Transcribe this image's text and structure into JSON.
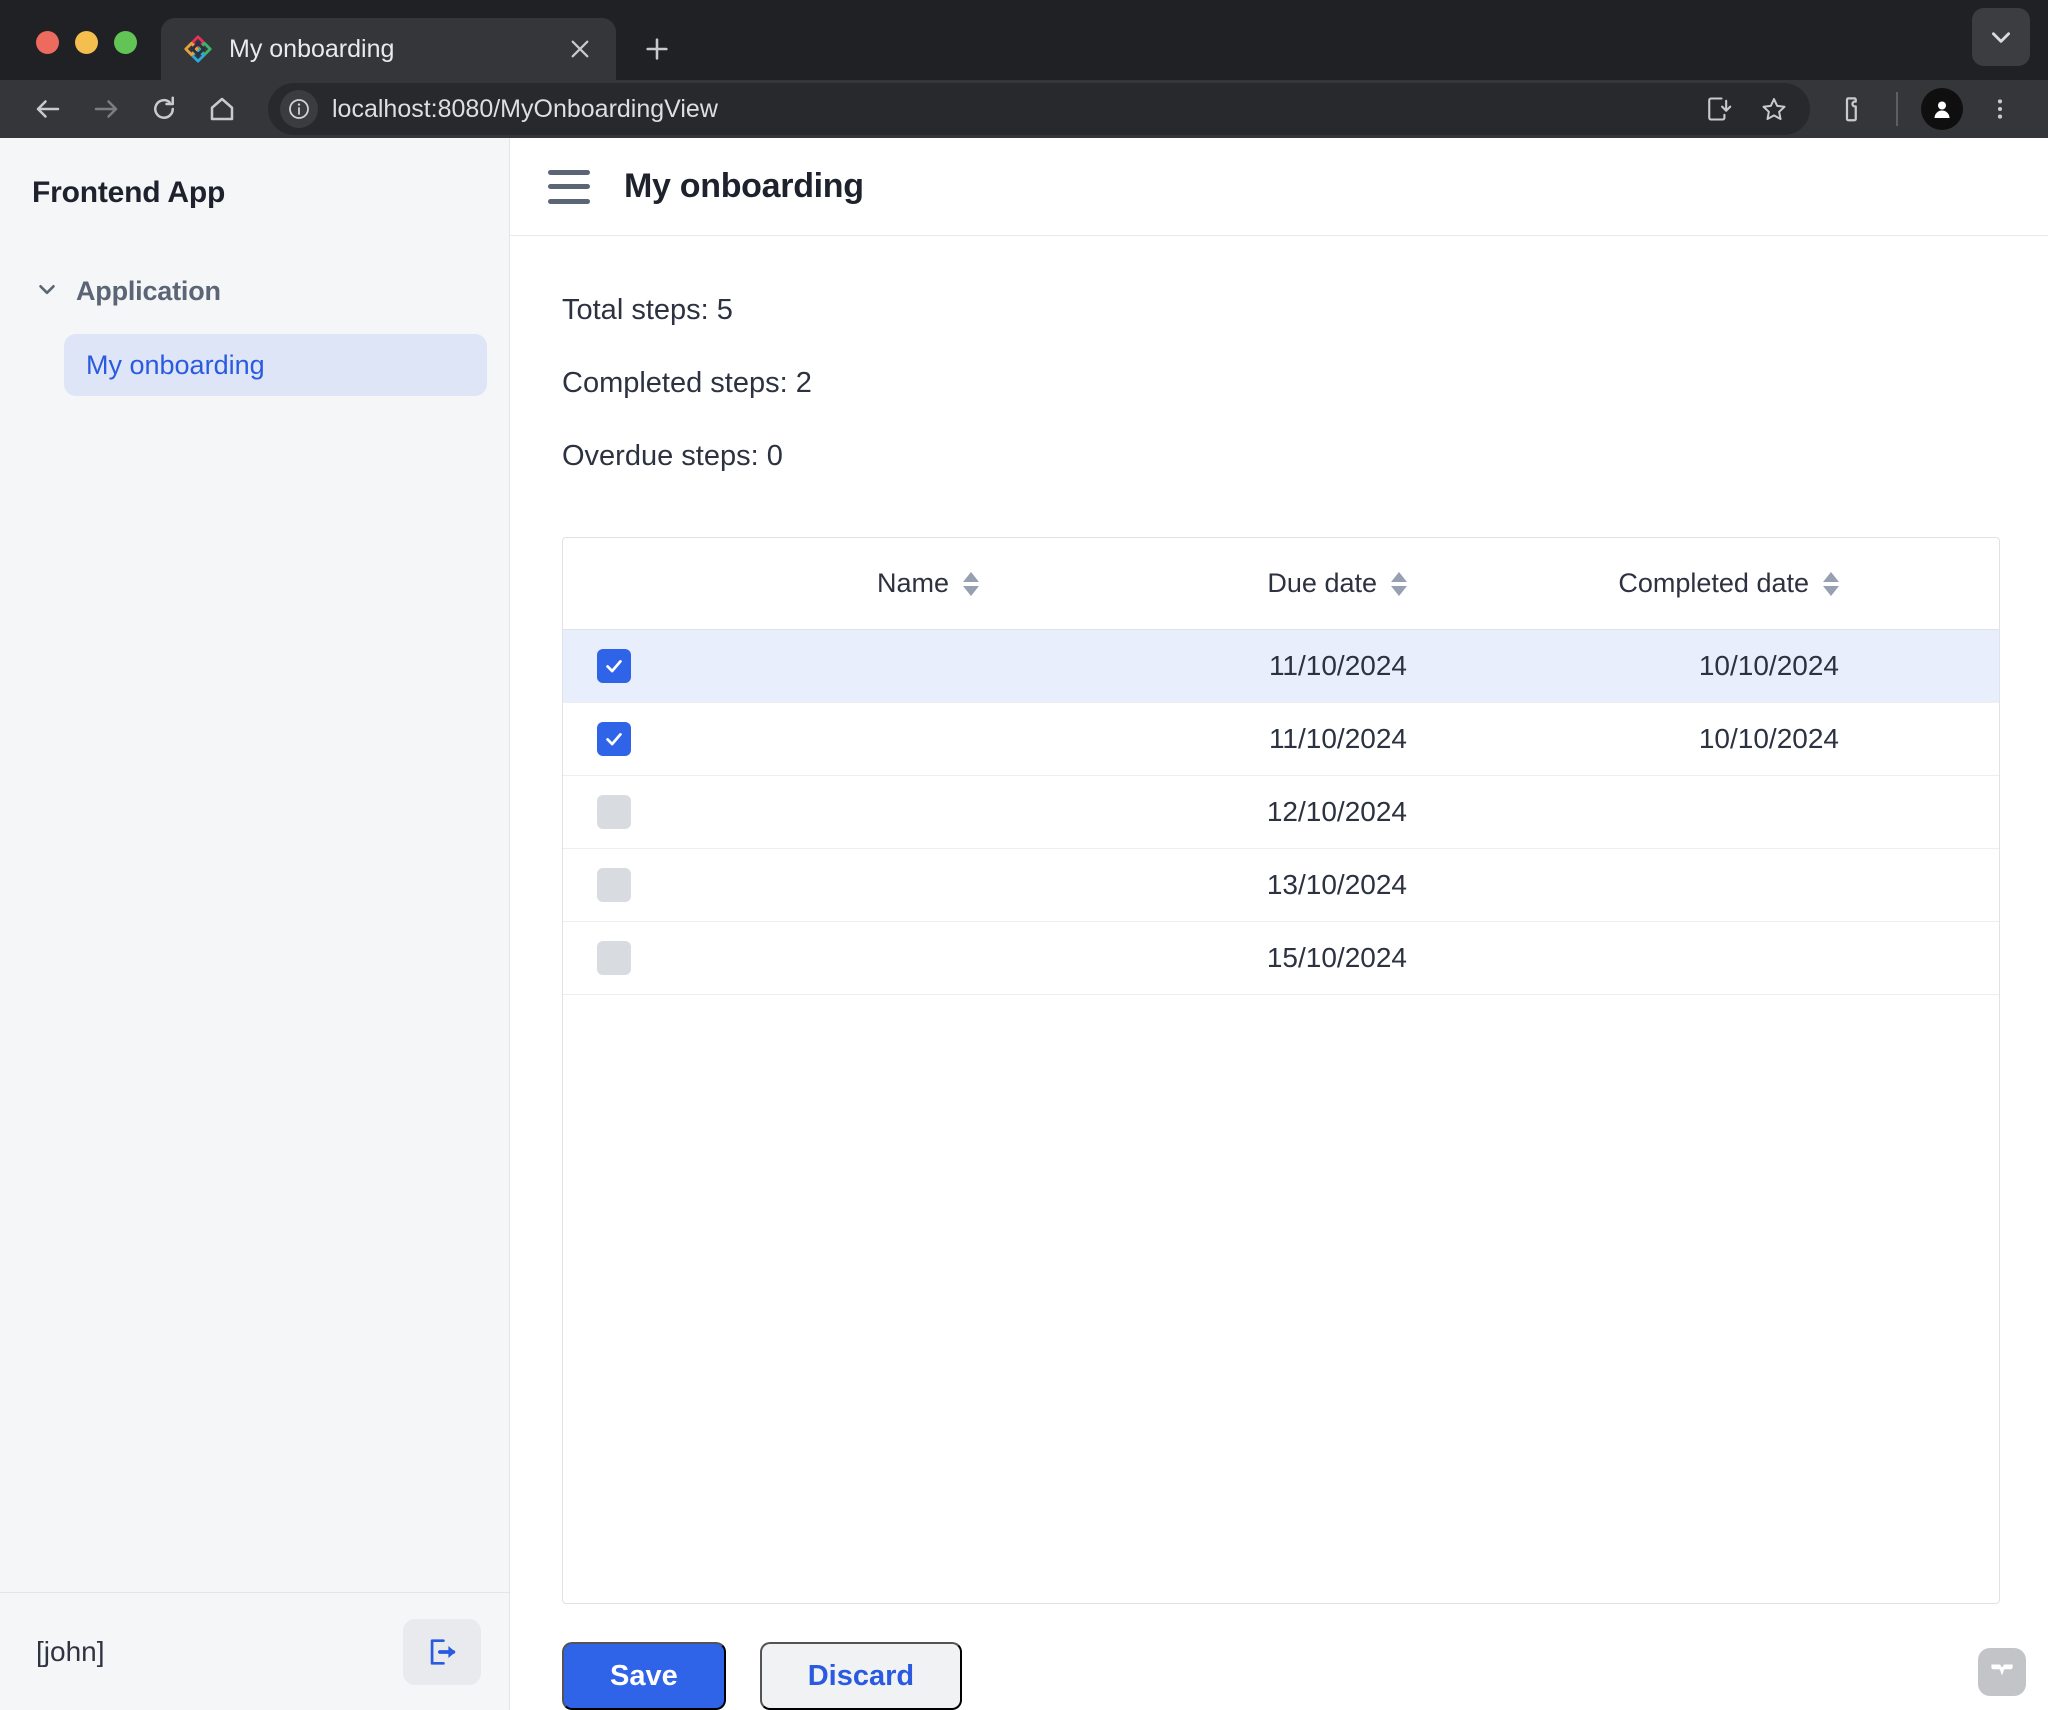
{
  "browser": {
    "tab": {
      "title": "My onboarding",
      "favicon_icon": "vaadin-diamond-icon",
      "close_icon": "close-icon"
    },
    "new_tab_icon": "plus-icon",
    "tab_list_icon": "chevron-down-icon",
    "nav": {
      "back_icon": "arrow-left-icon",
      "forward_icon": "arrow-right-icon",
      "reload_icon": "reload-icon",
      "home_icon": "home-icon"
    },
    "omnibox": {
      "site_info_icon": "info-circle-icon",
      "url": "localhost:8080/MyOnboardingView",
      "install_icon": "install-app-icon",
      "bookmark_icon": "star-icon"
    },
    "extensions_icon": "extensions-puzzle-icon",
    "profile_icon": "profile-avatar-icon",
    "menu_icon": "three-dots-menu-icon"
  },
  "sidebar": {
    "app_title": "Frontend App",
    "sections": [
      {
        "label": "Application",
        "expand_icon": "chevron-down-icon",
        "items": [
          {
            "label": "My onboarding",
            "active": true
          }
        ]
      }
    ],
    "footer": {
      "user": "[john]",
      "logout_icon": "logout-icon"
    }
  },
  "main": {
    "menu_toggle_icon": "hamburger-menu-icon",
    "title": "My onboarding",
    "stats": [
      "Total steps: 5",
      "Completed steps: 2",
      "Overdue steps: 0"
    ],
    "grid": {
      "columns": [
        {
          "label": "Name",
          "sort_icon": "sort-arrows-icon"
        },
        {
          "label": "Due date",
          "sort_icon": "sort-arrows-icon"
        },
        {
          "label": "Completed date",
          "sort_icon": "sort-arrows-icon"
        }
      ],
      "rows": [
        {
          "checked": true,
          "name": "",
          "due_date": "11/10/2024",
          "completed_date": "10/10/2024",
          "selected": true
        },
        {
          "checked": true,
          "name": "",
          "due_date": "11/10/2024",
          "completed_date": "10/10/2024",
          "selected": false
        },
        {
          "checked": false,
          "name": "",
          "due_date": "12/10/2024",
          "completed_date": "",
          "selected": false
        },
        {
          "checked": false,
          "name": "",
          "due_date": "13/10/2024",
          "completed_date": "",
          "selected": false
        },
        {
          "checked": false,
          "name": "",
          "due_date": "15/10/2024",
          "completed_date": "",
          "selected": false
        }
      ]
    },
    "actions": {
      "save_label": "Save",
      "discard_label": "Discard"
    },
    "badge_icon": "vaadin-logo-icon"
  },
  "colors": {
    "accent": "#2f63e8",
    "selected_row": "#e8eefb",
    "sidebar_bg": "#f5f6f8",
    "nav_active_bg": "#dde5f7"
  }
}
